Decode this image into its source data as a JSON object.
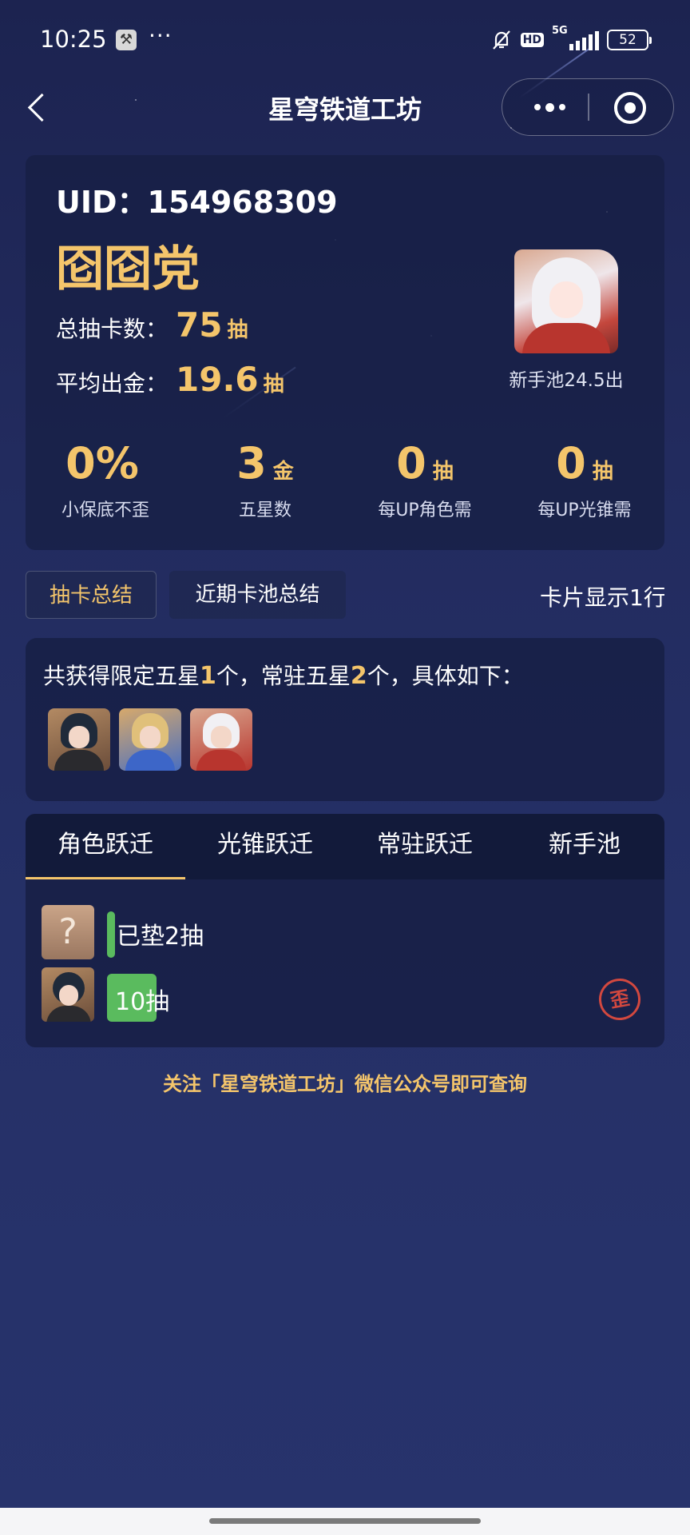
{
  "status_bar": {
    "time": "10:25",
    "wrench_icon": "wrench-icon",
    "more_dots": "···",
    "hd_label": "HD",
    "network_label": "5G",
    "battery_level": "52"
  },
  "nav": {
    "title": "星穹铁道工坊",
    "back_icon": "chevron-left-icon",
    "more_icon": "more-dots-icon",
    "close_icon": "target-close-icon"
  },
  "profile": {
    "uid_label": "UID：",
    "uid": "154968309",
    "nickname": "囵囵党",
    "total_pulls_label": "总抽卡数：",
    "total_pulls_value": "75",
    "total_pulls_unit": "抽",
    "avg_gold_label": "平均出金：",
    "avg_gold_value": "19.6",
    "avg_gold_unit": "抽",
    "avatar_caption": "新手池24.5出"
  },
  "metrics": [
    {
      "value": "0%",
      "unit": "",
      "caption": "小保底不歪"
    },
    {
      "value": "3",
      "unit": "金",
      "caption": "五星数"
    },
    {
      "value": "0",
      "unit": "抽",
      "caption": "每UP角色需"
    },
    {
      "value": "0",
      "unit": "抽",
      "caption": "每UP光锥需"
    }
  ],
  "summary_tabs": {
    "active": "抽卡总结",
    "other": "近期卡池总结",
    "card_display": "卡片显示1行"
  },
  "summary": {
    "prefix": "共获得限定五星",
    "limited_count": "1",
    "middle": "个，常驻五星",
    "standard_count": "2",
    "suffix": "个，具体如下："
  },
  "warp_tabs": [
    "角色跃迁",
    "光锥跃迁",
    "常驻跃迁",
    "新手池"
  ],
  "warp_records": {
    "pity_unknown_glyph": "?",
    "pity_text": "已垫2抽",
    "record_text": "10抽",
    "lost_badge": "歪"
  },
  "footer": {
    "note": "关注「星穹铁道工坊」微信公众号即可查询"
  },
  "colors": {
    "accent_gold": "#f4c56b",
    "green": "#5abb5e",
    "badge_red": "#d2483f",
    "bg": "#222b5e"
  }
}
